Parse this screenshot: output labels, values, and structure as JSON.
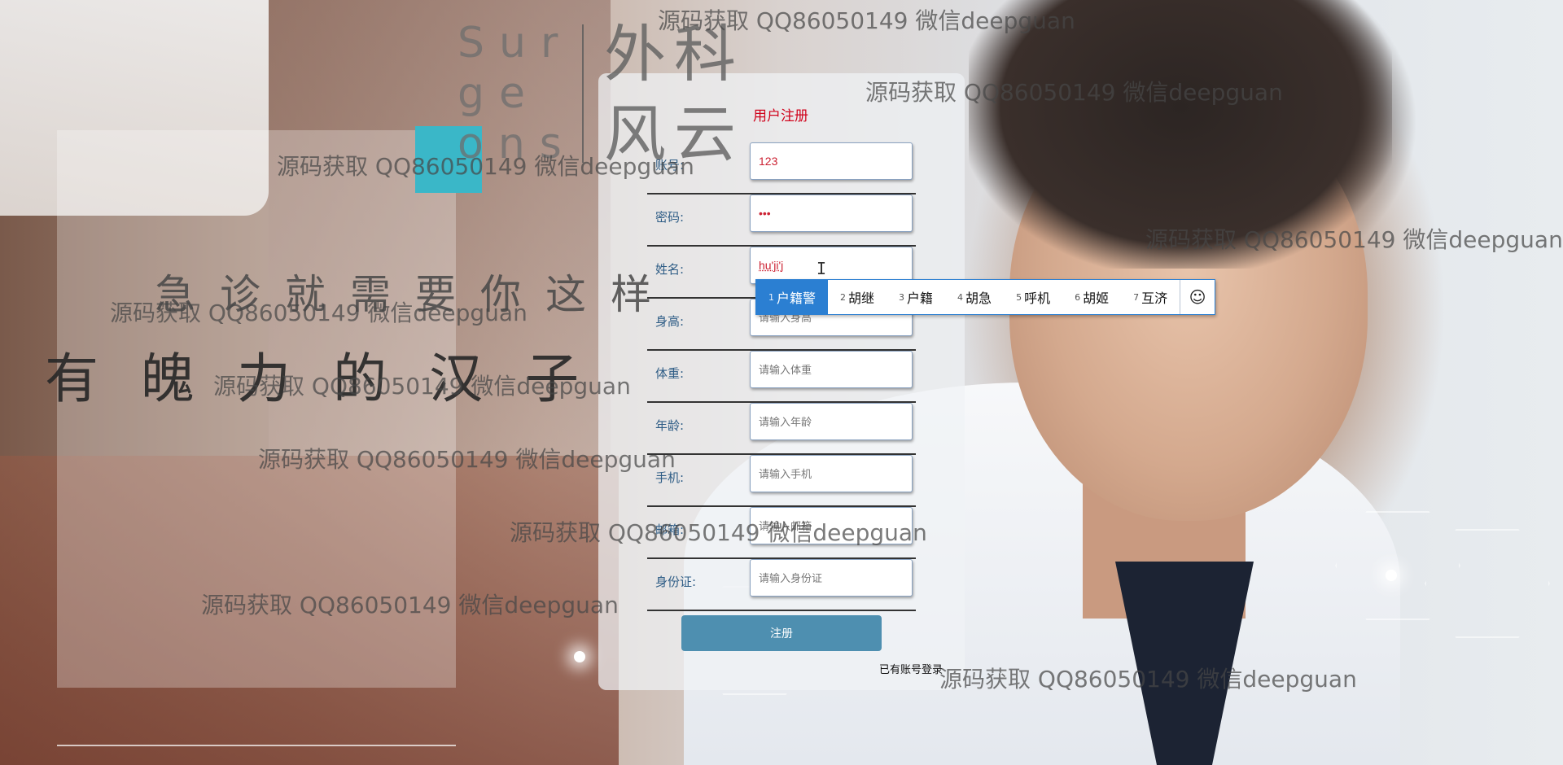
{
  "branding": {
    "english_text": "Surgeons",
    "chinese_text": "外科风云",
    "slogan_line1": "急诊就需要你这样",
    "slogan_line2": "有魄力的汉子"
  },
  "form": {
    "title": "用户注册",
    "fields": [
      {
        "label": "账号:",
        "value": "123",
        "placeholder": ""
      },
      {
        "label": "密码:",
        "value": "•••",
        "placeholder": ""
      },
      {
        "label": "姓名:",
        "value": "hu'ji'j",
        "placeholder": ""
      },
      {
        "label": "身高:",
        "value": "",
        "placeholder": "请输入身高"
      },
      {
        "label": "体重:",
        "value": "",
        "placeholder": "请输入体重"
      },
      {
        "label": "年龄:",
        "value": "",
        "placeholder": "请输入年龄"
      },
      {
        "label": "手机:",
        "value": "",
        "placeholder": "请输入手机"
      },
      {
        "label": "邮箱:",
        "value": "",
        "placeholder": "请输入邮箱"
      },
      {
        "label": "身份证:",
        "value": "",
        "placeholder": "请输入身份证"
      }
    ],
    "submit_label": "注册",
    "login_link": "已有账号登录"
  },
  "ime": {
    "candidates": [
      {
        "num": "1",
        "text": "户籍警"
      },
      {
        "num": "2",
        "text": "胡继"
      },
      {
        "num": "3",
        "text": "户籍"
      },
      {
        "num": "4",
        "text": "胡急"
      },
      {
        "num": "5",
        "text": "呼机"
      },
      {
        "num": "6",
        "text": "胡姬"
      },
      {
        "num": "7",
        "text": "互济"
      }
    ],
    "emoji_icon": "☺"
  },
  "watermark": {
    "text": "源码获取 QQ86050149 微信deepguan"
  },
  "colors": {
    "title_red": "#d0021b",
    "button_blue": "#4e8fb0",
    "accent_teal": "#3ab7c8",
    "ime_selected": "#2b7fd2"
  }
}
